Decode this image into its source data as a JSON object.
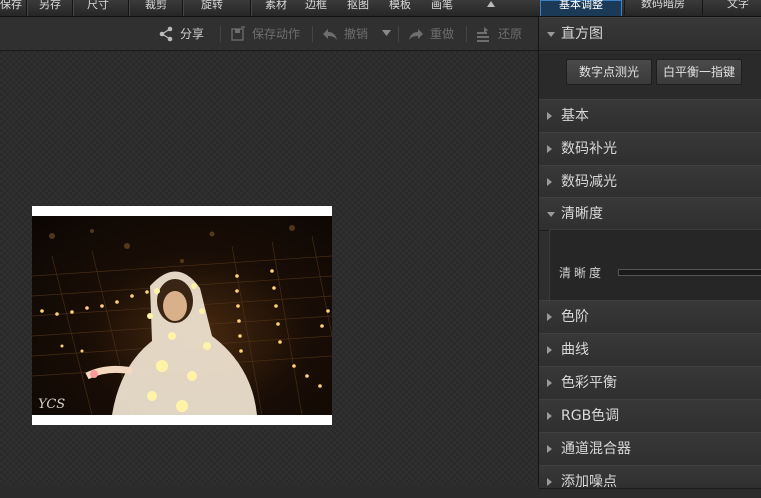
{
  "menubar": {
    "items": [
      "保存",
      "另存",
      "尺寸",
      "裁剪",
      "旋转",
      "素材",
      "边框",
      "抠图",
      "模板",
      "画笔"
    ],
    "tabs": [
      {
        "label": "基本调整",
        "active": true
      },
      {
        "label": "数码暗房",
        "active": false
      },
      {
        "label": "文字",
        "active": false
      }
    ]
  },
  "toolbar": {
    "share": "分享",
    "save_action": "保存动作",
    "undo": "撤销",
    "redo": "重做",
    "restore": "还原"
  },
  "photo": {
    "watermark": "YCS"
  },
  "panel": {
    "histogram": {
      "title": "直方图",
      "digital_metering": "数字点测光",
      "white_balance": "白平衡一指键"
    },
    "sections": [
      "基本",
      "数码补光",
      "数码减光",
      "清晰度",
      "色阶",
      "曲线",
      "色彩平衡",
      "RGB色调",
      "通道混合器",
      "添加噪点"
    ],
    "sharpness": {
      "label": "清晰度",
      "level": 0
    }
  },
  "colors": {
    "accent": "#3f7fc3",
    "active_tab_bg": "#1b3a57",
    "panel_bg": "#2e2e2e"
  }
}
